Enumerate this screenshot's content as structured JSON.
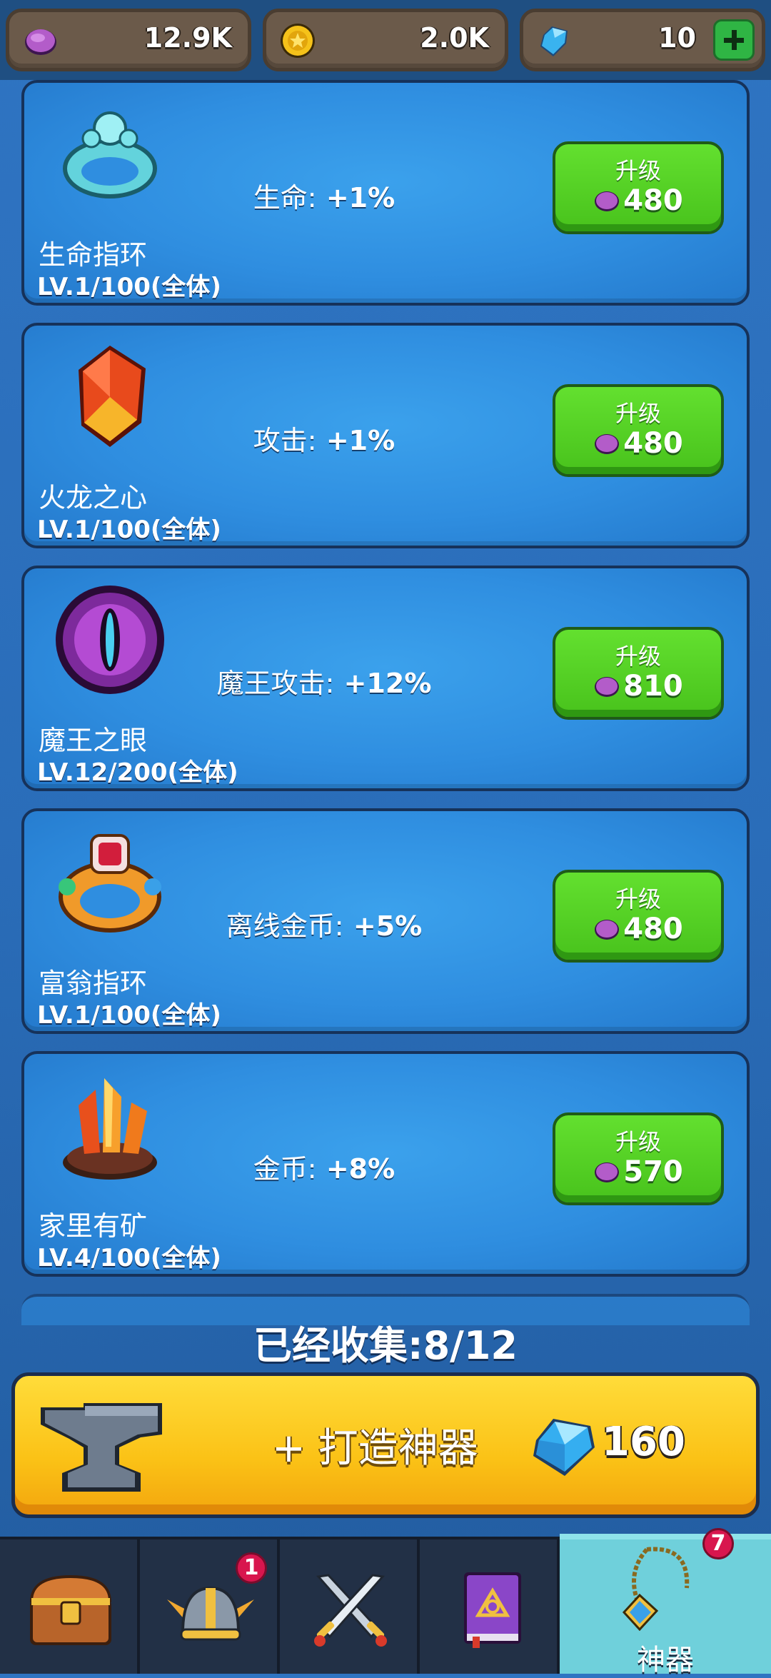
{
  "currencies": {
    "purple": "12.9K",
    "gold": "2.0K",
    "gems": "10"
  },
  "upgrade_label": "升级",
  "artifacts": [
    {
      "name": "生命指环",
      "level": "LV.1/100(全体)",
      "effect_label": "生命:",
      "effect_value": " +1%",
      "cost": "480"
    },
    {
      "name": "火龙之心",
      "level": "LV.1/100(全体)",
      "effect_label": "攻击:",
      "effect_value": " +1%",
      "cost": "480"
    },
    {
      "name": "魔王之眼",
      "level": "LV.12/200(全体)",
      "effect_label": "魔王攻击:",
      "effect_value": " +12%",
      "cost": "810"
    },
    {
      "name": "富翁指环",
      "level": "LV.1/100(全体)",
      "effect_label": "离线金币:",
      "effect_value": " +5%",
      "cost": "480"
    },
    {
      "name": "家里有矿",
      "level": "LV.4/100(全体)",
      "effect_label": "金币:",
      "effect_value": " +8%",
      "cost": "570"
    }
  ],
  "collected": "已经收集:8/12",
  "forge": {
    "label": "+ 打造神器",
    "price": "160"
  },
  "nav": {
    "tabs": [
      {
        "icon": "treasure-chest-icon"
      },
      {
        "icon": "viking-helmet-icon",
        "badge": "1"
      },
      {
        "icon": "crossed-swords-icon"
      },
      {
        "icon": "spell-book-icon"
      },
      {
        "icon": "amulet-icon",
        "badge": "7",
        "label": "神器",
        "active": true
      }
    ]
  },
  "colors": {
    "background": "#2f74c2",
    "card": "#2f8ee0",
    "upgrade_button": "#48c21c",
    "forge_button": "#fbc216",
    "active_tab": "#6fd0db",
    "badge": "#d8164e"
  }
}
